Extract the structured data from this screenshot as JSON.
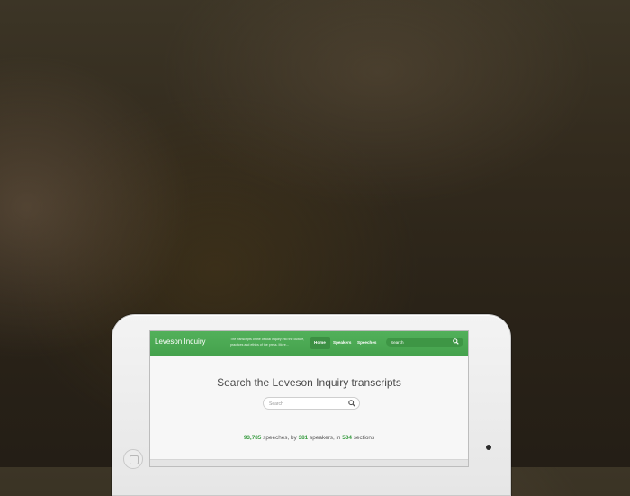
{
  "site": {
    "brand": "Leveson Inquiry",
    "tagline": "The transcripts of the official Inquiry into the culture, practices and ethics of the press. More…"
  },
  "nav": {
    "items": [
      {
        "label": "Home",
        "active": true
      },
      {
        "label": "Speakers"
      },
      {
        "label": "Speeches"
      }
    ],
    "search_placeholder": "Search"
  },
  "hero": {
    "title": "Search the Leveson Inquiry transcripts",
    "search_placeholder": "Search"
  },
  "stats": {
    "speeches_count": "93,785",
    "speeches_label": " speeches, by ",
    "speakers_count": "381",
    "speakers_label": " speakers, in ",
    "sections_count": "534",
    "sections_label": " sections"
  },
  "colors": {
    "accent_green": "#4caf50",
    "bezel": "#eeeeee",
    "background": "#2f281c"
  },
  "icons": {
    "nav_search": "search-icon",
    "hero_search": "search-icon"
  }
}
